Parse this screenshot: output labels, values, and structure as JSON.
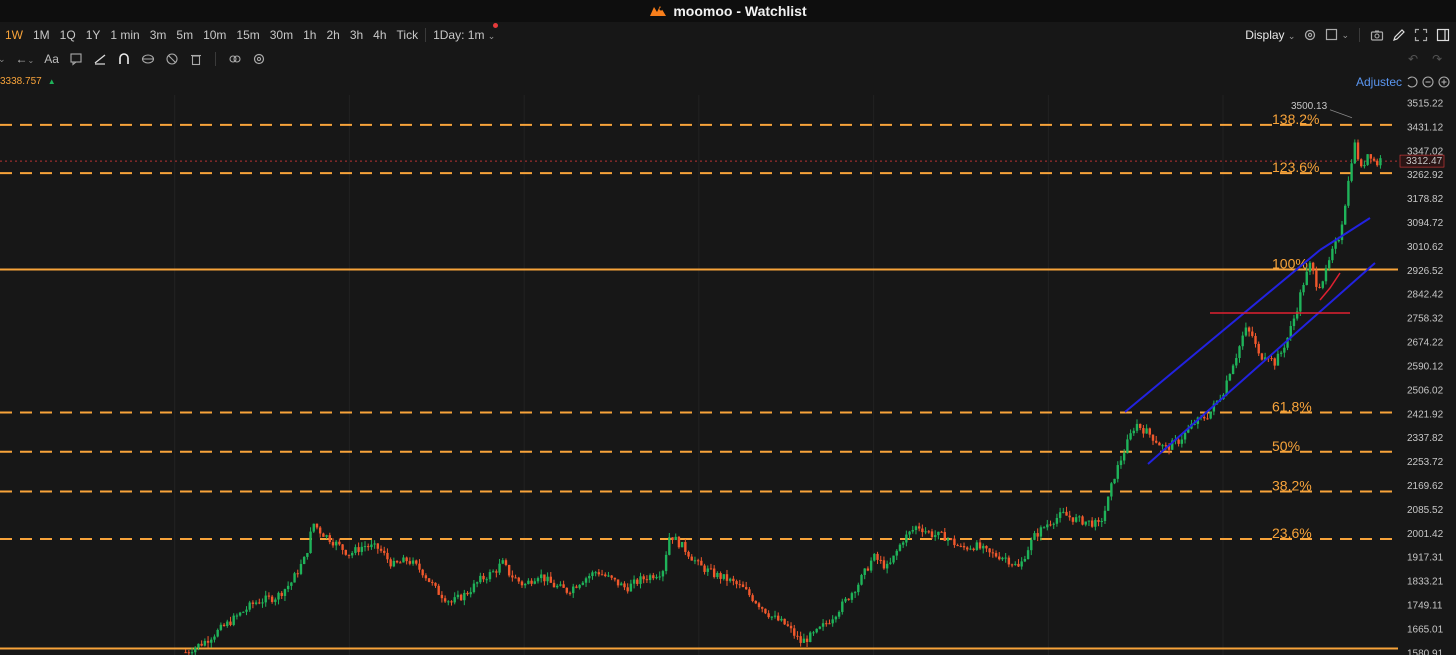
{
  "window": {
    "title": "moomoo - Watchlist",
    "logo_icon": "moomoo-logo-icon"
  },
  "toolbar": {
    "timeframes": [
      "1W",
      "1M",
      "1Q",
      "1Y",
      "1 min",
      "3m",
      "5m",
      "10m",
      "15m",
      "30m",
      "1h",
      "2h",
      "3h",
      "4h",
      "Tick"
    ],
    "active_timeframe": "1W",
    "day_selector": "1Day: 1m",
    "display_label": "Display"
  },
  "drawbar": {
    "text_tool": "Aa"
  },
  "price_header": {
    "value": "3338.757"
  },
  "adjusted_label": "Adjustec",
  "colors": {
    "accent": "#f7a33a",
    "up": "#1fb35a",
    "down": "#f0582c",
    "channel": "#2222e0",
    "red_line": "#e02030",
    "current_price": "#e03b3b"
  },
  "chart_data": {
    "type": "candlestick",
    "y_axis": {
      "ticks": [
        "3515.22",
        "3431.12",
        "3347.02",
        "3262.92",
        "3178.82",
        "3094.72",
        "3010.62",
        "2926.52",
        "2842.42",
        "2758.32",
        "2674.22",
        "2590.12",
        "2506.02",
        "2421.92",
        "2337.82",
        "2253.72",
        "2169.62",
        "2085.52",
        "2001.42",
        "1917.31",
        "1833.21",
        "1749.11",
        "1665.01",
        "1580.91"
      ],
      "ylim": [
        1575.0,
        3545.0
      ]
    },
    "current_price": "3312.47",
    "high_annotation": "3500.13",
    "fib_levels": [
      {
        "label": "138.2%",
        "value": 3440.0,
        "style": "dashed"
      },
      {
        "label": "123.6%",
        "value": 3270.0,
        "style": "dashed"
      },
      {
        "label": "100%",
        "value": 2931.0,
        "style": "solid"
      },
      {
        "label": "61.8%",
        "value": 2428.0,
        "style": "dashed"
      },
      {
        "label": "50%",
        "value": 2290.0,
        "style": "dashed"
      },
      {
        "label": "38.2%",
        "value": 2150.0,
        "style": "dashed"
      },
      {
        "label": "23.6%",
        "value": 1983.0,
        "style": "dashed"
      },
      {
        "label": "",
        "value": 1598.0,
        "style": "solid"
      }
    ],
    "price_path": [
      [
        0.1275,
        1585
      ],
      [
        0.14,
        1620
      ],
      [
        0.16,
        1700
      ],
      [
        0.175,
        1760
      ],
      [
        0.19,
        1780
      ],
      [
        0.2,
        1830
      ],
      [
        0.21,
        1920
      ],
      [
        0.215,
        2040
      ],
      [
        0.22,
        2010
      ],
      [
        0.23,
        1970
      ],
      [
        0.24,
        1930
      ],
      [
        0.25,
        1960
      ],
      [
        0.26,
        1950
      ],
      [
        0.27,
        1890
      ],
      [
        0.28,
        1910
      ],
      [
        0.29,
        1870
      ],
      [
        0.3,
        1800
      ],
      [
        0.31,
        1760
      ],
      [
        0.32,
        1790
      ],
      [
        0.33,
        1840
      ],
      [
        0.34,
        1870
      ],
      [
        0.345,
        1900
      ],
      [
        0.35,
        1860
      ],
      [
        0.36,
        1820
      ],
      [
        0.37,
        1860
      ],
      [
        0.38,
        1820
      ],
      [
        0.39,
        1800
      ],
      [
        0.4,
        1840
      ],
      [
        0.41,
        1870
      ],
      [
        0.42,
        1840
      ],
      [
        0.43,
        1810
      ],
      [
        0.44,
        1840
      ],
      [
        0.455,
        1870
      ],
      [
        0.46,
        2000
      ],
      [
        0.47,
        1950
      ],
      [
        0.48,
        1890
      ],
      [
        0.49,
        1860
      ],
      [
        0.5,
        1840
      ],
      [
        0.51,
        1810
      ],
      [
        0.52,
        1760
      ],
      [
        0.53,
        1710
      ],
      [
        0.54,
        1680
      ],
      [
        0.55,
        1620
      ],
      [
        0.56,
        1650
      ],
      [
        0.57,
        1700
      ],
      [
        0.58,
        1760
      ],
      [
        0.59,
        1830
      ],
      [
        0.6,
        1920
      ],
      [
        0.61,
        1880
      ],
      [
        0.62,
        1980
      ],
      [
        0.63,
        2030
      ],
      [
        0.64,
        2000
      ],
      [
        0.65,
        1990
      ],
      [
        0.66,
        1950
      ],
      [
        0.67,
        1960
      ],
      [
        0.68,
        1930
      ],
      [
        0.69,
        1920
      ],
      [
        0.7,
        1880
      ],
      [
        0.705,
        1940
      ],
      [
        0.71,
        1990
      ],
      [
        0.72,
        2040
      ],
      [
        0.73,
        2070
      ],
      [
        0.74,
        2050
      ],
      [
        0.75,
        2040
      ],
      [
        0.755,
        2030
      ],
      [
        0.76,
        2100
      ],
      [
        0.765,
        2200
      ],
      [
        0.775,
        2330
      ],
      [
        0.78,
        2390
      ],
      [
        0.79,
        2350
      ],
      [
        0.8,
        2300
      ],
      [
        0.81,
        2330
      ],
      [
        0.82,
        2390
      ],
      [
        0.83,
        2420
      ],
      [
        0.84,
        2500
      ],
      [
        0.845,
        2580
      ],
      [
        0.85,
        2640
      ],
      [
        0.855,
        2720
      ],
      [
        0.86,
        2700
      ],
      [
        0.865,
        2620
      ],
      [
        0.87,
        2640
      ],
      [
        0.875,
        2600
      ],
      [
        0.88,
        2640
      ],
      [
        0.885,
        2700
      ],
      [
        0.89,
        2780
      ],
      [
        0.895,
        2880
      ],
      [
        0.9,
        2950
      ],
      [
        0.905,
        2870
      ],
      [
        0.91,
        2910
      ],
      [
        0.915,
        2990
      ],
      [
        0.92,
        3050
      ],
      [
        0.925,
        3200
      ],
      [
        0.93,
        3380
      ],
      [
        0.935,
        3280
      ],
      [
        0.94,
        3350
      ],
      [
        0.945,
        3300
      ],
      [
        0.95,
        3330
      ]
    ]
  }
}
